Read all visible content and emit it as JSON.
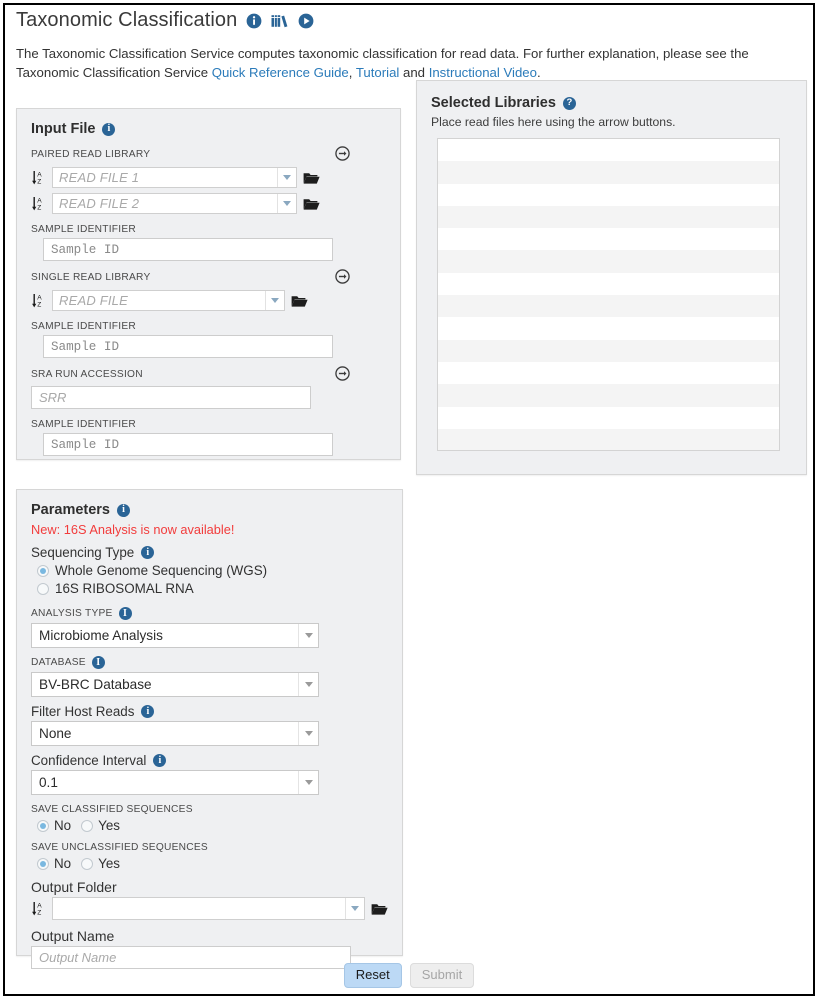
{
  "header": {
    "title": "Taxonomic Classification",
    "icons": [
      "info-circle-icon",
      "library-books-icon",
      "play-video-icon"
    ],
    "description_line1": "The Taxonomic Classification Service computes taxonomic classification for read data. For further explanation, please see the",
    "description_line2_prefix": "Taxonomic Classification Service ",
    "link_quick_reference": "Quick Reference Guide",
    "link_sep1": ", ",
    "link_tutorial": "Tutorial",
    "link_sep2": " and ",
    "link_video": "Instructional Video",
    "description_end": "."
  },
  "input_file": {
    "title": "Input File",
    "paired_read_library_label": "PAIRED READ LIBRARY",
    "read_file_1_placeholder": "READ FILE 1",
    "read_file_2_placeholder": "READ FILE 2",
    "sample_identifier_label": "SAMPLE IDENTIFIER",
    "sample_id_placeholder_paired": "Sample ID",
    "single_read_library_label": "SINGLE READ LIBRARY",
    "read_file_placeholder": "READ FILE",
    "sample_id_placeholder_single": "Sample ID",
    "sra_run_accession_label": "SRA RUN ACCESSION",
    "srr_placeholder": "SRR",
    "sample_id_placeholder_sra": "Sample ID"
  },
  "selected_libraries": {
    "title": "Selected Libraries",
    "subtitle": "Place read files here using the arrow buttons.",
    "row_count": 14,
    "items": []
  },
  "parameters": {
    "title": "Parameters",
    "new_notice": "New: 16S Analysis is now available!",
    "sequencing_type_label": "Sequencing Type",
    "sequencing_options": [
      {
        "label": "Whole Genome Sequencing (WGS)",
        "checked": true
      },
      {
        "label": "16S RIBOSOMAL RNA",
        "checked": false
      }
    ],
    "analysis_type_label": "ANALYSIS TYPE",
    "analysis_type_value": "Microbiome Analysis",
    "database_label": "DATABASE",
    "database_value": "BV-BRC Database",
    "filter_host_reads_label": "Filter Host Reads",
    "filter_host_reads_value": "None",
    "confidence_interval_label": "Confidence Interval",
    "confidence_interval_value": "0.1",
    "save_classified_label": "SAVE CLASSIFIED SEQUENCES",
    "save_classified_no": "No",
    "save_classified_yes": "Yes",
    "save_classified_selected": "No",
    "save_unclassified_label": "SAVE UNCLASSIFIED SEQUENCES",
    "save_unclassified_no": "No",
    "save_unclassified_yes": "Yes",
    "save_unclassified_selected": "No",
    "output_folder_label": "Output Folder",
    "output_folder_value": "",
    "output_name_label": "Output Name",
    "output_name_placeholder": "Output Name"
  },
  "actions": {
    "reset_label": "Reset",
    "submit_label": "Submit",
    "submit_disabled": true
  },
  "colors": {
    "accent_blue": "#2a6496",
    "link_blue": "#2b7bba",
    "notice_red": "#f23c3c",
    "panel_bg": "#eff0f2",
    "reset_btn": "#bcd9f5"
  }
}
